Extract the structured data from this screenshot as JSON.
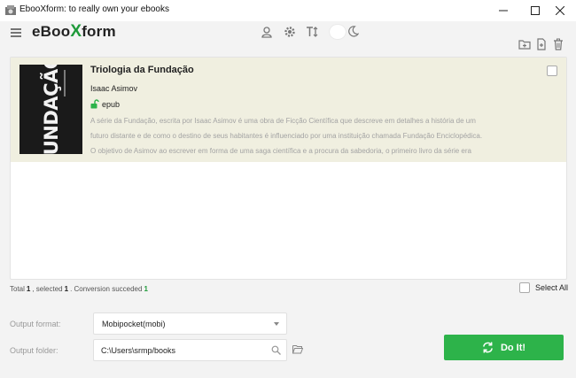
{
  "window": {
    "title": "EbooXform: to really own your ebooks"
  },
  "toolbar": {
    "logo_prefix": "eBoo",
    "logo_x": "X",
    "logo_suffix": "form"
  },
  "books": [
    {
      "title": "Triologia da Fundação",
      "author": "Isaac Asimov",
      "format": "epub",
      "cover_text": "FUNDAÇÃO",
      "description_lines": [
        "A série da Fundação, escrita por Isaac Asimov é uma obra de Ficção Científica que descreve em detalhes a história de um",
        "futuro distante e de como o destino de seus habitantes é influenciado por uma instituição chamada Fundação Enciclopédica.",
        "O objetivo de Asimov ao escrever em forma de uma saga científica e a procura da sabedoria, o primeiro livro da série era"
      ],
      "selected": false
    }
  ],
  "status": {
    "total_label": "Total",
    "total": "1",
    "selected_label": ", selected",
    "selected": "1",
    "conversion_label": ". Conversion succeded",
    "succeeded": "1"
  },
  "select_all_label": "Select All",
  "output": {
    "format_label": "Output format:",
    "format_value": "Mobipocket(mobi)",
    "folder_label": "Output folder:",
    "folder_value": "C:\\Users\\srmp/books"
  },
  "do_it_label": "Do It!",
  "colors": {
    "accent": "#2db34a",
    "row_highlight": "#f0efe0"
  }
}
